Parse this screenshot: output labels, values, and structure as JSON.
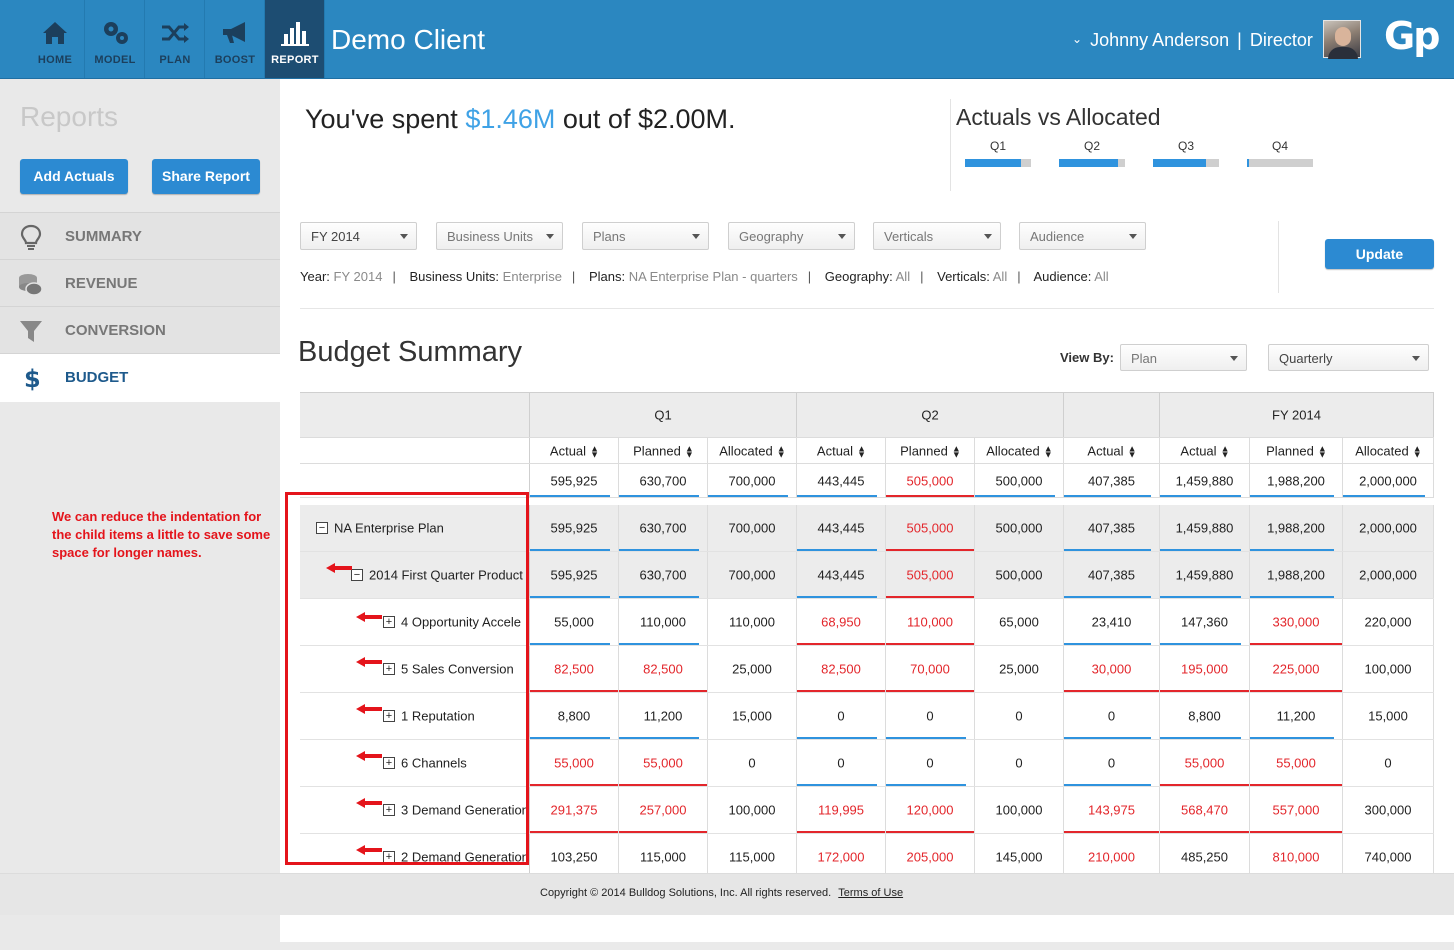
{
  "nav": [
    {
      "label": "HOME",
      "icon": "home-icon"
    },
    {
      "label": "MODEL",
      "icon": "gears-icon"
    },
    {
      "label": "PLAN",
      "icon": "shuffle-icon"
    },
    {
      "label": "BOOST",
      "icon": "megaphone-icon"
    },
    {
      "label": "REPORT",
      "icon": "bar-chart-icon"
    }
  ],
  "header": {
    "client": "Demo Client",
    "user_name": "Johnny Anderson",
    "separator": "|",
    "user_role": "Director",
    "logo": "Gp"
  },
  "sidebar": {
    "title": "Reports",
    "add_actuals": "Add Actuals",
    "share_report": "Share Report",
    "items": [
      {
        "label": "SUMMARY",
        "icon": "lightbulb-icon"
      },
      {
        "label": "REVENUE",
        "icon": "coins-icon"
      },
      {
        "label": "CONVERSION",
        "icon": "funnel-icon"
      },
      {
        "label": "BUDGET",
        "icon": "dollar-icon"
      }
    ]
  },
  "spent": {
    "prefix": "You've spent",
    "amount": "$1.46M",
    "suffix": "out of $2.00M."
  },
  "actuals_vs_allocated": {
    "title": "Actuals vs Allocated",
    "quarters": [
      {
        "label": "Q1",
        "fraction": 0.85
      },
      {
        "label": "Q2",
        "fraction": 0.89
      },
      {
        "label": "Q3",
        "fraction": 0.81
      },
      {
        "label": "Q4",
        "fraction": 0.03
      }
    ]
  },
  "filters": {
    "year": "FY 2014",
    "business_units": "Business Units",
    "plans": "Plans",
    "geography": "Geography",
    "verticals": "Verticals",
    "audience": "Audience",
    "update": "Update"
  },
  "summary_line": {
    "year_label": "Year:",
    "year_value": "FY 2014",
    "bu_label": "Business Units:",
    "bu_value": "Enterprise",
    "plans_label": "Plans:",
    "plans_value": "NA Enterprise Plan - quarters",
    "geo_label": "Geography:",
    "geo_value": "All",
    "vert_label": "Verticals:",
    "vert_value": "All",
    "aud_label": "Audience:",
    "aud_value": "All"
  },
  "budget": {
    "title": "Budget Summary",
    "view_by_label": "View By:",
    "view_by_value": "Plan",
    "period_value": "Quarterly"
  },
  "table": {
    "groups": [
      "Q1",
      "Q2",
      "FY 2014"
    ],
    "columns": [
      "Actual",
      "Planned",
      "Allocated",
      "Actual",
      "Planned",
      "Allocated",
      "Actual",
      "Actual",
      "Planned",
      "Allocated"
    ],
    "totals": [
      "595,925",
      "630,700",
      "700,000",
      "443,445",
      "505,000",
      "500,000",
      "407,385",
      "1,459,880",
      "1,988,200",
      "2,000,000"
    ],
    "rows": [
      {
        "name": "NA Enterprise Plan",
        "toggle": "−",
        "values": [
          "595,925",
          "630,700",
          "700,000",
          "443,445",
          "505,000",
          "500,000",
          "407,385",
          "1,459,880",
          "1,988,200",
          "2,000,000"
        ]
      },
      {
        "name": "2014 First Quarter Product",
        "toggle": "−",
        "values": [
          "595,925",
          "630,700",
          "700,000",
          "443,445",
          "505,000",
          "500,000",
          "407,385",
          "1,459,880",
          "1,988,200",
          "2,000,000"
        ]
      },
      {
        "name": "4 Opportunity Accele",
        "toggle": "+",
        "values": [
          "55,000",
          "110,000",
          "110,000",
          "68,950",
          "110,000",
          "65,000",
          "23,410",
          "147,360",
          "330,000",
          "220,000"
        ]
      },
      {
        "name": "5 Sales Conversion",
        "toggle": "+",
        "values": [
          "82,500",
          "82,500",
          "25,000",
          "82,500",
          "70,000",
          "25,000",
          "30,000",
          "195,000",
          "225,000",
          "100,000"
        ]
      },
      {
        "name": "1 Reputation",
        "toggle": "+",
        "values": [
          "8,800",
          "11,200",
          "15,000",
          "0",
          "0",
          "0",
          "0",
          "8,800",
          "11,200",
          "15,000"
        ]
      },
      {
        "name": "6 Channels",
        "toggle": "+",
        "values": [
          "55,000",
          "55,000",
          "0",
          "0",
          "0",
          "0",
          "0",
          "55,000",
          "55,000",
          "0"
        ]
      },
      {
        "name": "3 Demand Generation",
        "toggle": "+",
        "values": [
          "291,375",
          "257,000",
          "100,000",
          "119,995",
          "120,000",
          "100,000",
          "143,975",
          "568,470",
          "557,000",
          "300,000"
        ]
      },
      {
        "name": "2 Demand Generation",
        "toggle": "+",
        "values": [
          "103,250",
          "115,000",
          "115,000",
          "172,000",
          "205,000",
          "145,000",
          "210,000",
          "485,250",
          "810,000",
          "740,000"
        ]
      }
    ]
  },
  "annotation": {
    "text": "We can reduce the indentation for the child items a little to save some space for longer names."
  },
  "footer": {
    "copyright": "Copyright © 2014 Bulldog Solutions, Inc. All rights reserved.",
    "terms": "Terms of Use"
  },
  "colors": {
    "brand_blue": "#2b87c0",
    "button_blue": "#2c8ad2",
    "highlight_blue": "#3fa2e6",
    "over_budget_red": "#e3262b",
    "annotation_red": "#e4141b"
  }
}
